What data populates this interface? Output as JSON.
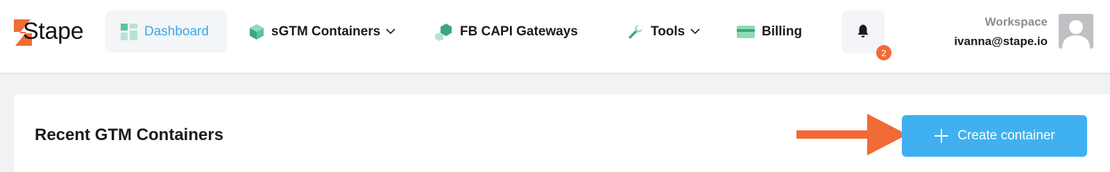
{
  "brand": {
    "logo_text": "Stape",
    "accent": "#f26a35"
  },
  "nav": {
    "dashboard": {
      "label": "Dashboard",
      "icon": "dashboard-grid-icon"
    },
    "sgtm": {
      "label": "sGTM Containers",
      "icon": "cube-icon"
    },
    "fb_capi": {
      "label": "FB CAPI Gateways",
      "icon": "hexagon-icon"
    },
    "tools": {
      "label": "Tools",
      "icon": "wrench-icon"
    },
    "billing": {
      "label": "Billing",
      "icon": "credit-card-icon"
    }
  },
  "notifications": {
    "count": "2",
    "icon": "bell-icon"
  },
  "user": {
    "workspace_label": "Workspace",
    "email": "ivanna@stape.io",
    "avatar_icon": "user-avatar-icon"
  },
  "main": {
    "section_title": "Recent GTM Containers",
    "create_button_label": "Create container",
    "primary_color": "#3fb1f0"
  }
}
